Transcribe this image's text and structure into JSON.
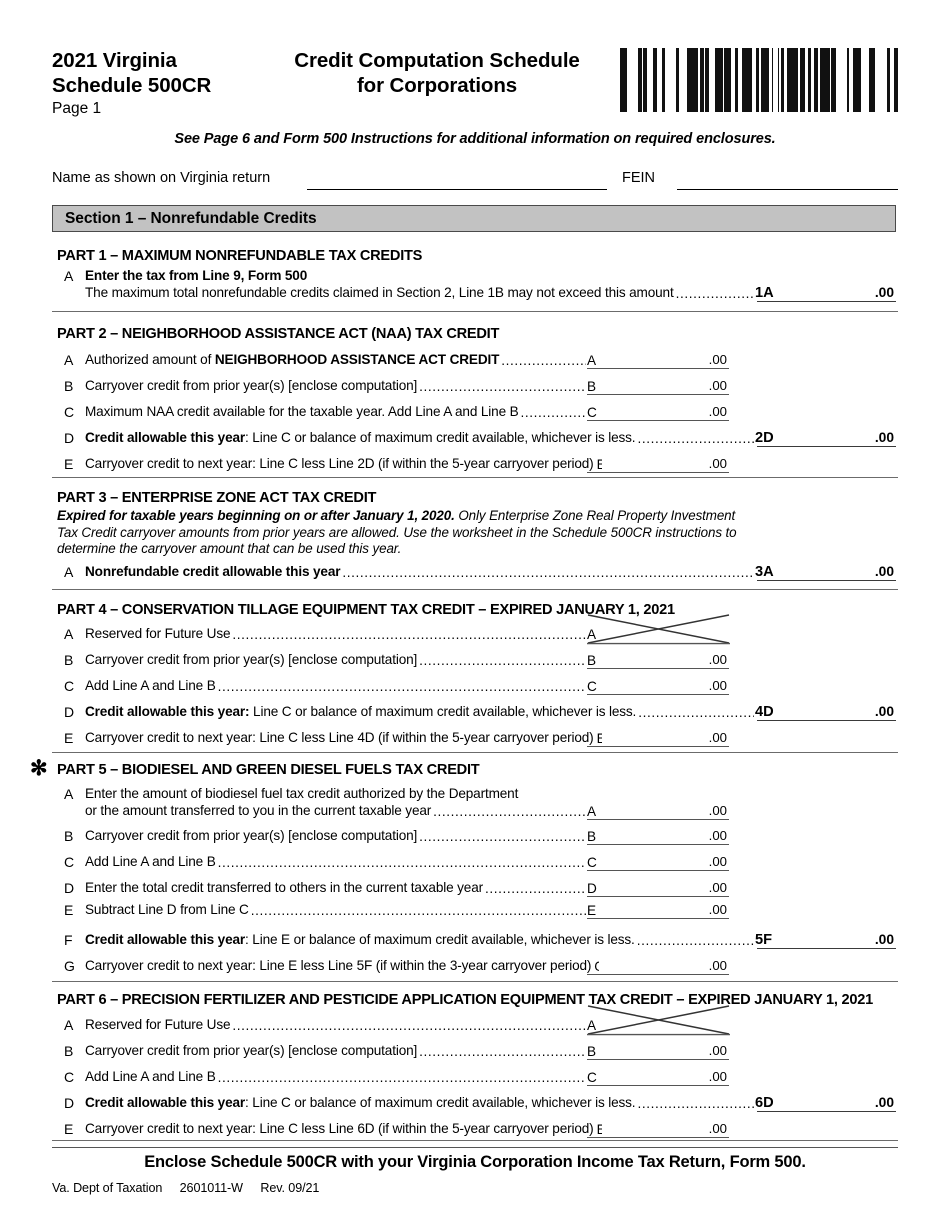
{
  "header": {
    "title_left_line1": "2021 Virginia",
    "title_left_line2": "Schedule 500CR",
    "page_label": "Page 1",
    "title_right_line1": "Credit Computation Schedule",
    "title_right_line2": "for Corporations",
    "barcode_name": "form-barcode"
  },
  "notice": "See Page 6 and Form 500 Instructions for additional information on required enclosures.",
  "identity": {
    "name_label": "Name as shown on Virginia return",
    "name_value": "",
    "fein_label": "FEIN",
    "fein_value": ""
  },
  "section": {
    "label": "Section 1 – Nonrefundable Credits"
  },
  "cents": ".00",
  "parts": [
    {
      "title": "PART 1 – MAXIMUM NONREFUNDABLE TAX CREDITS",
      "star": "",
      "note": "",
      "lines": [
        {
          "letter": "A",
          "text": "Enter the tax from Line 9, Form 500",
          "text_bold": true,
          "text2": "The maximum total nonrefundable credits claimed in Section 2, Line 1B may not exceed this amount",
          "code": "1A",
          "code_bold": true,
          "field": "outer",
          "value": ""
        }
      ]
    },
    {
      "title": "PART 2 – NEIGHBORHOOD ASSISTANCE ACT (NAA) TAX CREDIT",
      "star": "",
      "note": "",
      "lines": [
        {
          "letter": "A",
          "text": "Authorized amount of ",
          "text_strong": "NEIGHBORHOOD ASSISTANCE ACT CREDIT",
          "code": "A",
          "field": "inner",
          "value": ""
        },
        {
          "letter": "B",
          "text": "Carryover credit from prior year(s) [enclose computation]",
          "code": "B",
          "field": "inner",
          "value": ""
        },
        {
          "letter": "C",
          "text": "Maximum NAA credit available for the taxable year. Add Line A and Line B",
          "code": "C",
          "field": "inner",
          "value": ""
        },
        {
          "letter": "D",
          "text_strong": "Credit allowable this year",
          "text_after": ": Line C or balance of maximum credit available, whichever is less.",
          "code": "2D",
          "code_bold": true,
          "field": "outer",
          "value": ""
        },
        {
          "letter": "E",
          "text": "Carryover credit to next year: Line C less Line 2D (if within the 5-year carryover period)",
          "code": "E",
          "field": "inner",
          "value": ""
        }
      ]
    },
    {
      "title": "PART 3 – ENTERPRISE ZONE ACT TAX CREDIT",
      "star": "",
      "note_bold": "Expired for taxable years beginning on or after January 1, 2020.",
      "note": " Only Enterprise Zone Real Property Investment Tax Credit carryover amounts from prior years are allowed. Use the worksheet in the Schedule 500CR instructions to determine the carryover amount that can be used this year.",
      "lines": [
        {
          "letter": "A",
          "text": "Nonrefundable credit allowable this year",
          "text_bold": true,
          "code": "3A",
          "code_bold": true,
          "field": "outer",
          "value": ""
        }
      ]
    },
    {
      "title": "PART 4 – CONSERVATION TILLAGE EQUIPMENT TAX CREDIT – EXPIRED JANUARY 1, 2021",
      "star": "",
      "note": "",
      "lines": [
        {
          "letter": "A",
          "text": "Reserved for Future Use",
          "code": "A",
          "field": "crossed",
          "value": ""
        },
        {
          "letter": "B",
          "text": "Carryover credit from prior year(s) [enclose computation]",
          "code": "B",
          "field": "inner",
          "value": ""
        },
        {
          "letter": "C",
          "text": "Add Line A and Line B",
          "code": "C",
          "field": "inner",
          "value": ""
        },
        {
          "letter": "D",
          "text_strong": "Credit allowable this year:",
          "text_after": " Line C or balance of maximum credit available, whichever is less.",
          "code": "4D",
          "code_bold": true,
          "field": "outer",
          "value": ""
        },
        {
          "letter": "E",
          "text": "Carryover credit to next year: Line C less Line 4D (if within the 5-year carryover period)",
          "code": "E",
          "field": "inner",
          "value": ""
        }
      ]
    },
    {
      "title": "PART 5 – BIODIESEL AND GREEN DIESEL FUELS TAX CREDIT",
      "star": "✻",
      "note": "",
      "lines": [
        {
          "letter": "A",
          "text": "Enter the amount of biodiesel fuel tax credit authorized by the Department",
          "text2": "or the amount transferred to you in the current taxable year",
          "code": "A",
          "field": "inner",
          "value": ""
        },
        {
          "letter": "B",
          "text": "Carryover credit from prior year(s) [enclose computation]",
          "code": "B",
          "field": "inner",
          "value": ""
        },
        {
          "letter": "C",
          "text": "Add Line A and Line B",
          "code": "C",
          "field": "inner",
          "value": ""
        },
        {
          "letter": "D",
          "text": "Enter the total credit transferred to others in the current taxable year",
          "code": "D",
          "field": "inner",
          "value": ""
        },
        {
          "letter": "E",
          "text": "Subtract Line D from Line C",
          "code": "E",
          "field": "inner",
          "value": ""
        },
        {
          "letter": "F",
          "text_strong": "Credit allowable this year",
          "text_after": ": Line E or balance of maximum credit available, whichever is less.",
          "code": "5F",
          "code_bold": true,
          "field": "outer",
          "value": ""
        },
        {
          "letter": "G",
          "text": "Carryover credit to next year: Line E less Line 5F (if within the 3-year carryover period)",
          "code": "G",
          "field": "inner",
          "value": ""
        }
      ]
    },
    {
      "title": "PART 6 – PRECISION FERTILIZER AND PESTICIDE APPLICATION EQUIPMENT TAX CREDIT – EXPIRED JANUARY 1, 2021",
      "star": "",
      "note": "",
      "lines": [
        {
          "letter": "A",
          "text": "Reserved for Future Use",
          "code": "A",
          "field": "crossed",
          "value": ""
        },
        {
          "letter": "B",
          "text": "Carryover credit from prior year(s) [enclose computation]",
          "code": "B",
          "field": "inner",
          "value": ""
        },
        {
          "letter": "C",
          "text": "Add Line A and Line B",
          "code": "C",
          "field": "inner",
          "value": ""
        },
        {
          "letter": "D",
          "text_strong": "Credit allowable this year",
          "text_after": ": Line C or balance of maximum credit available, whichever is less.",
          "code": "6D",
          "code_bold": true,
          "field": "outer",
          "value": ""
        },
        {
          "letter": "E",
          "text": "Carryover credit to next year: Line C less Line 6D (if within the 5-year carryover period)",
          "code": "E",
          "field": "inner",
          "value": ""
        }
      ]
    }
  ],
  "footer": {
    "main": "Enclose Schedule 500CR with your Virginia Corporation Income Tax Return, Form 500.",
    "agency": "Va. Dept of Taxation",
    "form_number": "2601011-W",
    "revision": "Rev. 09/21"
  }
}
